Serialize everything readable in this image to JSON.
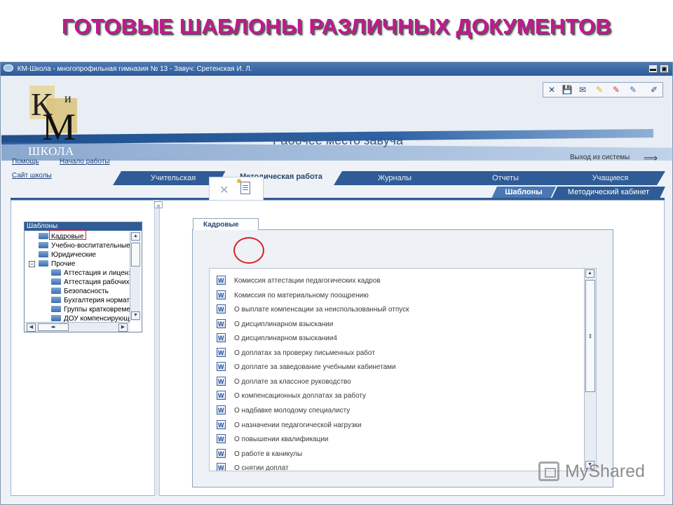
{
  "slide_title": "ГОТОВЫЕ ШАБЛОНЫ РАЗЛИЧНЫХ ДОКУМЕНТОВ",
  "window": {
    "title": "КМ-Школа - многопрофильная гимназия № 13 - Завуч: Сретенская И. Л.",
    "minimize_label": "▬",
    "maximize_label": "▣"
  },
  "logo": {
    "letter_k": "К",
    "letter_i": "и",
    "letter_m": "М",
    "school": "ШКОЛА"
  },
  "header": {
    "workplace_title": "Рабочее место завуча",
    "exit_label": "Выход из системы",
    "exit_arrow": "⟹"
  },
  "links": {
    "help": "Помощь",
    "start": "Начало работы",
    "site": "Сайт школы"
  },
  "main_tabs": [
    {
      "label": "Учительская"
    },
    {
      "label": "Методическая работа"
    },
    {
      "label": "Журналы"
    },
    {
      "label": "Отчеты"
    },
    {
      "label": "Учащиеся"
    }
  ],
  "sub_tabs": [
    {
      "label": "Шаблоны"
    },
    {
      "label": "Методический кабинет"
    }
  ],
  "tree": {
    "header": "Шаблоны",
    "expander_collapse": "−",
    "items": [
      {
        "label": "Кадровые"
      },
      {
        "label": "Учебно-воспитательные"
      },
      {
        "label": "Юридические"
      },
      {
        "label": "Прочие"
      },
      {
        "label": "Аттестация и лицензирование"
      },
      {
        "label": "Аттестация рабочих мест"
      },
      {
        "label": "Безопасность"
      },
      {
        "label": "Бухгалтерия нормативы"
      },
      {
        "label": "Группы кратковременного"
      },
      {
        "label": "ДОУ компенсирующего"
      }
    ]
  },
  "scroll": {
    "up": "▲",
    "down": "▼",
    "left": "◀",
    "right": "▶",
    "hthumb": "◂▸",
    "vthumb": "⇕"
  },
  "splitter_label": "«",
  "doc_group_tab": "Кадровые",
  "doc_toolbar": {
    "delete_glyph": "✕"
  },
  "documents": [
    "Комиссия аттестации педагогических кадров",
    "Комиссия по материальному поощрению",
    "О выплате компенсации за неиспользованный отпуск",
    "О дисциплинарном взыскании",
    "О дисциплинарном взыскании4",
    "О доплатах за проверку письменных работ",
    "О доплате за заведование учебными кабинетами",
    "О доплате за классное руководство",
    "О компенсационных доплатах за работу",
    "О надбавке молодому специалисту",
    "О назначении педагогической нагрузки",
    "О повышении квалификации",
    "О работе в каникулы",
    "О снятии доплат"
  ],
  "top_toolbar_icons": [
    "close-icon",
    "save-icon",
    "mail-icon",
    "pen-yellow-icon",
    "pen-red-icon",
    "pen-blue-icon",
    "edit-icon"
  ],
  "top_toolbar_glyphs": [
    "✕",
    "💾",
    "✉",
    "✎",
    "✎",
    "✎",
    "✐"
  ],
  "watermark": "MyShared",
  "colors": {
    "title": "#c2188e",
    "accent": "#2f5c96",
    "highlight": "#d81f2a"
  }
}
